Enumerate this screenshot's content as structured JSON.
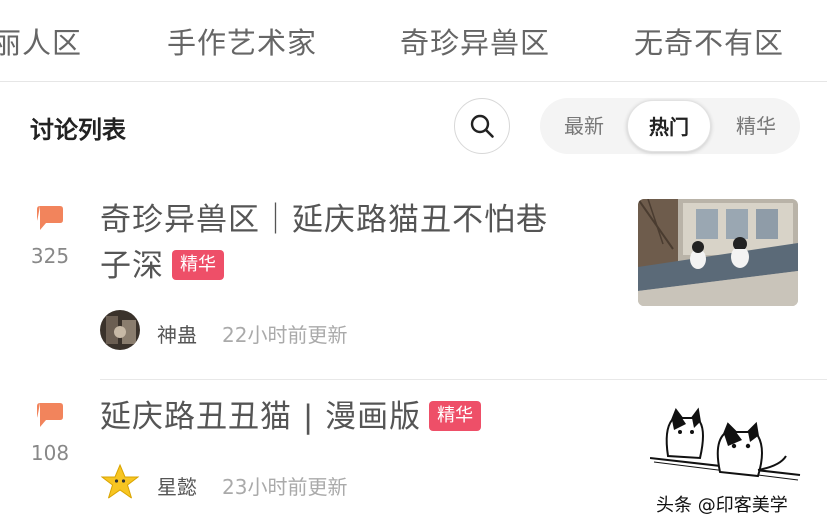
{
  "top_tabs": [
    "丽人区",
    "手作艺术家",
    "奇珍异兽区",
    "无奇不有区"
  ],
  "list_header": {
    "title": "讨论列表",
    "sort_options": [
      "最新",
      "热门",
      "精华"
    ],
    "active_sort": "热门"
  },
  "threads": [
    {
      "title_line1": "奇珍异兽区｜延庆路猫丑不怕巷",
      "title_line2": "子深",
      "badge": "精华",
      "reply_count": "325",
      "author": "神蛊",
      "updated": "22小时前更新"
    },
    {
      "title_line1": "延庆路丑丑猫 | 漫画版",
      "badge": "精华",
      "reply_count": "108",
      "author": "星懿",
      "updated": "23小时前更新"
    }
  ],
  "watermark": "头条 @印客美学",
  "colors": {
    "accent_orange": "#f2845c",
    "badge_red": "#ee4f68",
    "text_gray": "#555555",
    "muted_gray": "#aaaaaa"
  },
  "icons": [
    "search-icon",
    "comment-icon",
    "star-icon"
  ]
}
